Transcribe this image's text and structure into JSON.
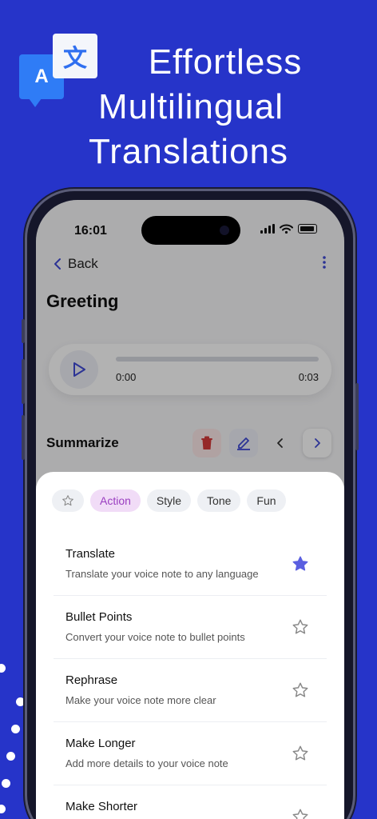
{
  "promo": {
    "logo_letter_a": "A",
    "logo_letter_zh": "文",
    "headline": [
      "Effortless",
      "Multilingual",
      "Translations"
    ]
  },
  "status_bar": {
    "time": "16:01"
  },
  "nav": {
    "back_label": "Back"
  },
  "note": {
    "title": "Greeting"
  },
  "player": {
    "current_time": "0:00",
    "duration": "0:03",
    "progress": 0
  },
  "summarize": {
    "label": "Summarize"
  },
  "sheet": {
    "chips": [
      {
        "label": "Action",
        "active": true
      },
      {
        "label": "Style",
        "active": false
      },
      {
        "label": "Tone",
        "active": false
      },
      {
        "label": "Fun",
        "active": false
      }
    ],
    "items": [
      {
        "name": "Translate",
        "desc": "Translate your voice note to any language",
        "favorite": true
      },
      {
        "name": "Bullet Points",
        "desc": "Convert your voice note to bullet points",
        "favorite": false
      },
      {
        "name": "Rephrase",
        "desc": "Make your voice note more clear",
        "favorite": false
      },
      {
        "name": "Make Longer",
        "desc": "Add more details to your voice note",
        "favorite": false
      },
      {
        "name": "Make Shorter",
        "desc": "",
        "favorite": false
      }
    ]
  },
  "colors": {
    "background": "#2634c9",
    "accent": "#5a5fe0",
    "chip_active_bg": "#f1dcf7",
    "chip_active_text": "#9a3ec1",
    "delete_red": "#d63a3a"
  },
  "icons": {
    "logo": "translate-logo-icon",
    "back": "chevron-left-icon",
    "menu": "more-vertical-icon",
    "play": "play-icon",
    "delete": "trash-icon",
    "edit": "pencil-icon",
    "prev": "chevron-left-icon",
    "next": "chevron-right-icon",
    "favorite": "star-icon"
  }
}
